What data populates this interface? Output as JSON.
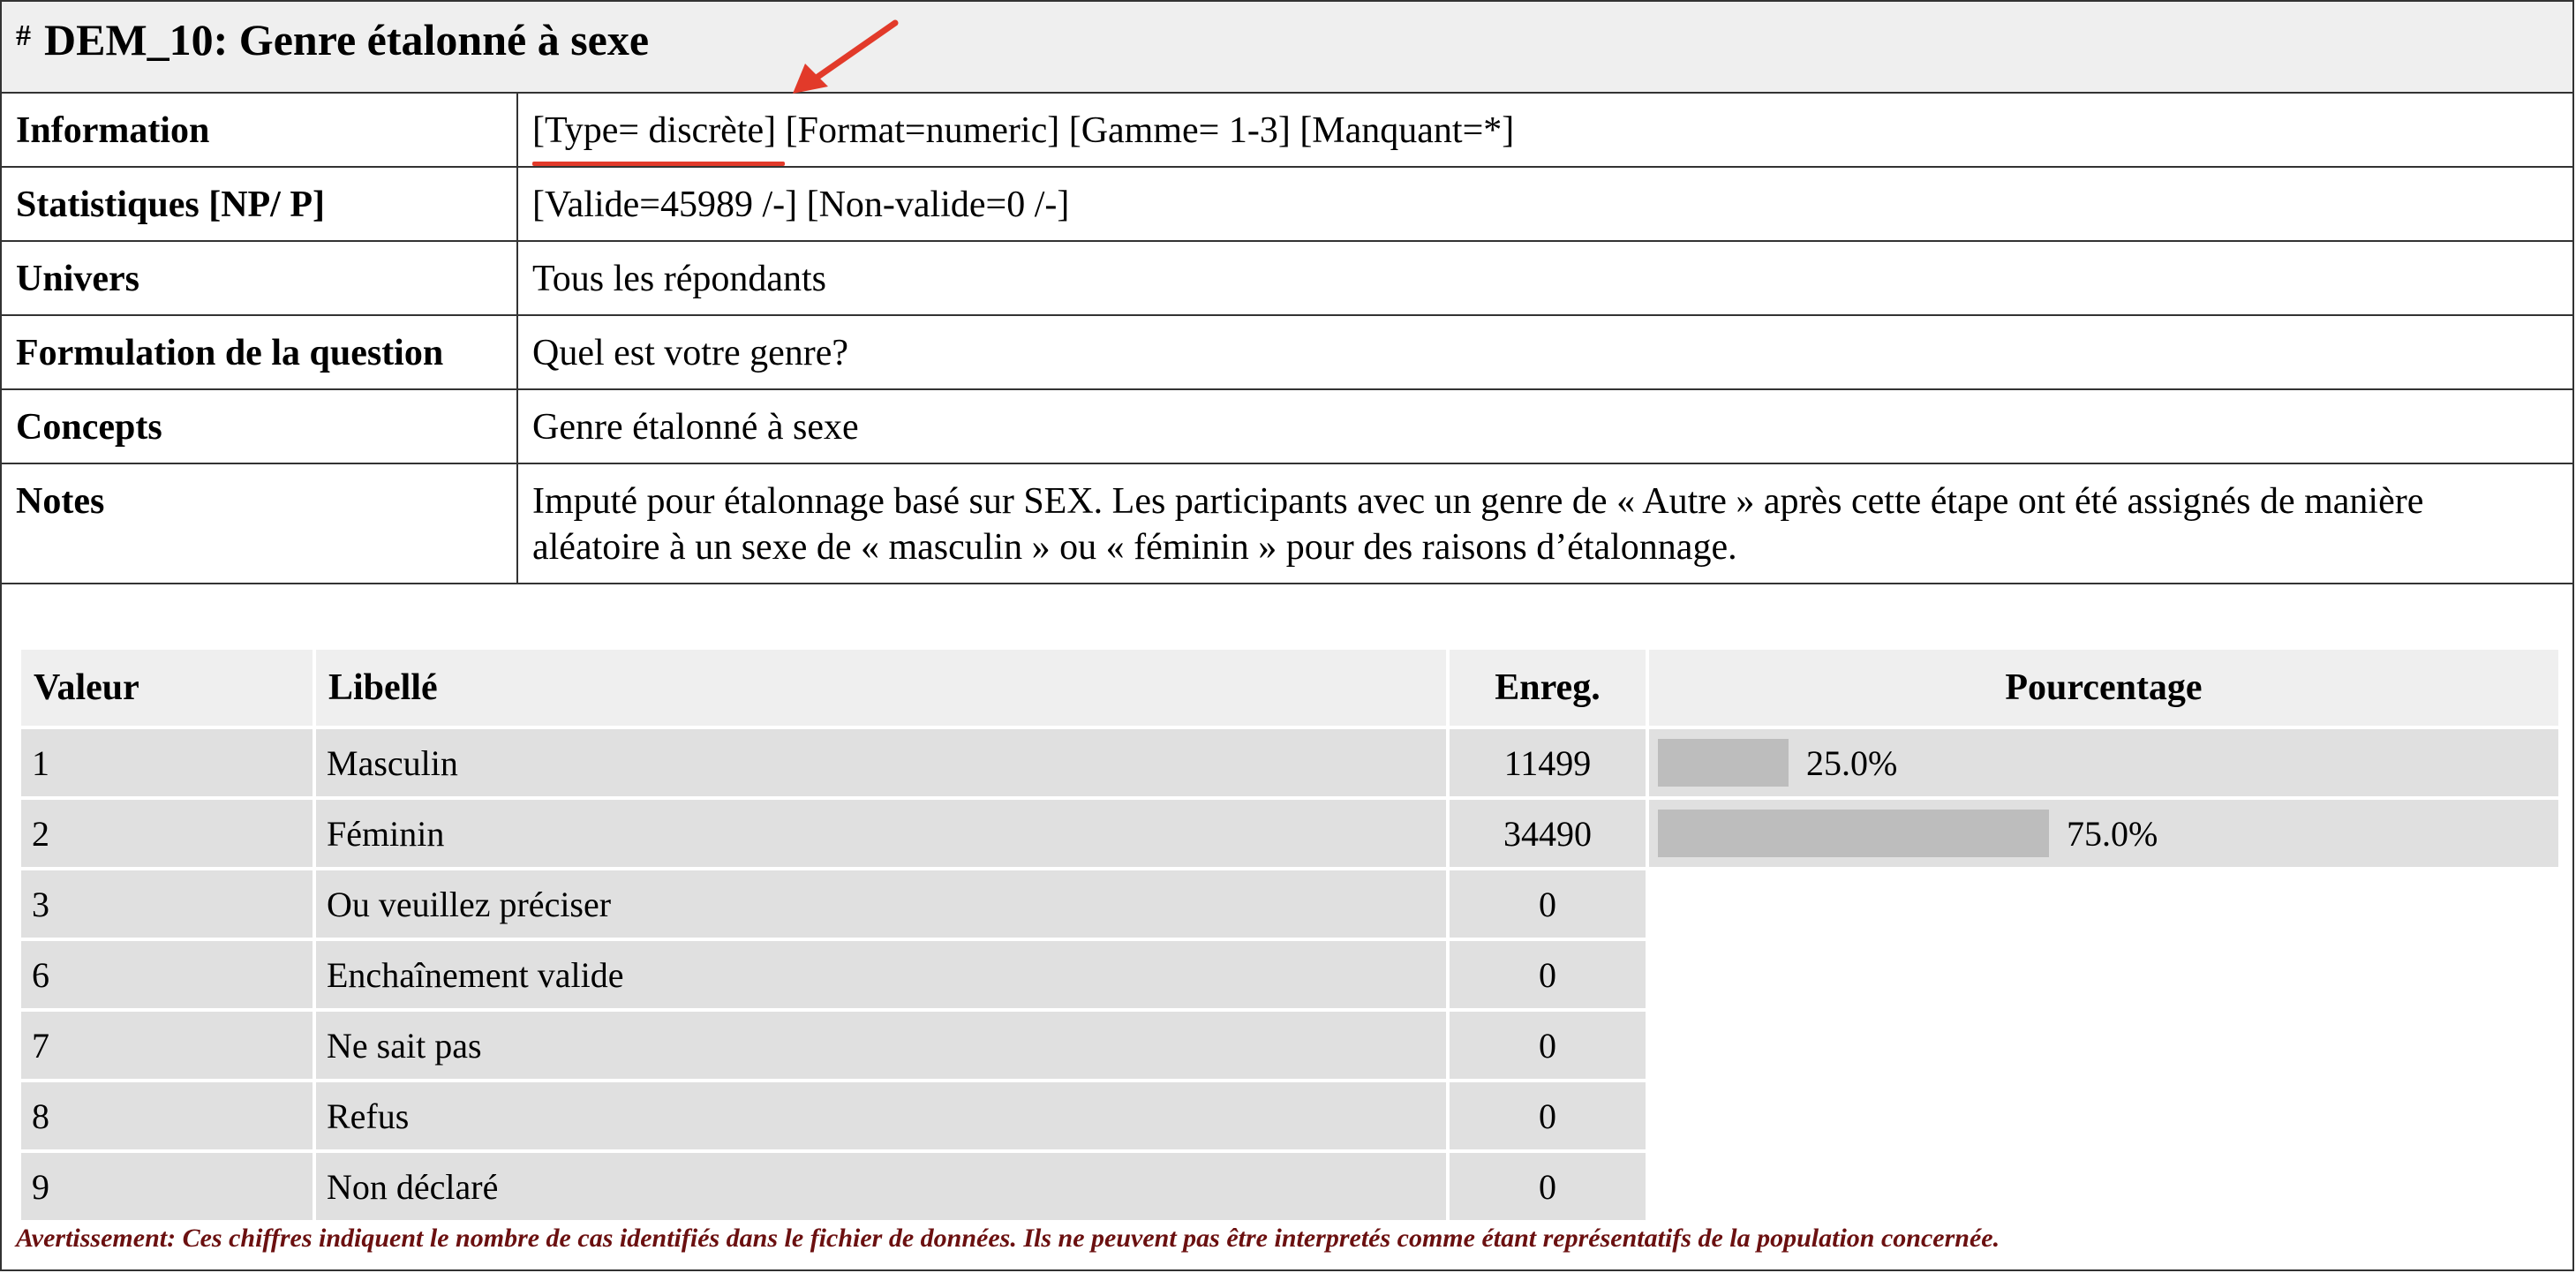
{
  "title": {
    "hash": "#",
    "text": "DEM_10: Genre étalonné à sexe"
  },
  "info_rows": [
    {
      "label": "Information",
      "value_parts": [
        "[Type= discrète]",
        " [Format=numeric] [Gamme= 1-3] [Manquant=*]"
      ]
    },
    {
      "label": "Statistiques [NP/ P]",
      "value": "[Valide=45989 /-] [Non-valide=0 /-]"
    },
    {
      "label": "Univers",
      "value": "Tous les répondants"
    },
    {
      "label": "Formulation de la question",
      "value": "Quel est votre genre?"
    },
    {
      "label": "Concepts",
      "value": "Genre étalonné à sexe"
    },
    {
      "label": "Notes",
      "value": "Imputé pour étalonnage basé sur SEX. Les participants avec un genre de « Autre » après cette étape ont été assignés de manière aléatoire à un sexe de « masculin » ou « féminin » pour des raisons d’étalonnage."
    }
  ],
  "freq_table": {
    "headers": {
      "valeur": "Valeur",
      "libelle": "Libellé",
      "enreg": "Enreg.",
      "pourcentage": "Pourcentage"
    },
    "rows": [
      {
        "valeur": "1",
        "libelle": "Masculin",
        "enreg": "11499",
        "pct": "25.0%",
        "pct_value": 0.25
      },
      {
        "valeur": "2",
        "libelle": "Féminin",
        "enreg": "34490",
        "pct": "75.0%",
        "pct_value": 0.75
      },
      {
        "valeur": "3",
        "libelle": "Ou veuillez préciser",
        "enreg": "0"
      },
      {
        "valeur": "6",
        "libelle": "Enchaînement valide",
        "enreg": "0"
      },
      {
        "valeur": "7",
        "libelle": "Ne sait pas",
        "enreg": "0"
      },
      {
        "valeur": "8",
        "libelle": "Refus",
        "enreg": "0"
      },
      {
        "valeur": "9",
        "libelle": "Non déclaré",
        "enreg": "0"
      }
    ]
  },
  "warning": "Avertissement: Ces chiffres indiquent le nombre de cas identifiés dans le fichier de données. Ils ne peuvent pas être interpretés comme étant représentatifs de la population concernée.",
  "colors": {
    "annotation": "#e23a2a",
    "header_bg": "#efefef",
    "cell_bg": "#e0e0e0",
    "bar": "#bdbdbd",
    "warning_text": "#6b1010"
  },
  "annotations": [
    {
      "type": "arrow-icon"
    },
    {
      "type": "underline"
    }
  ]
}
